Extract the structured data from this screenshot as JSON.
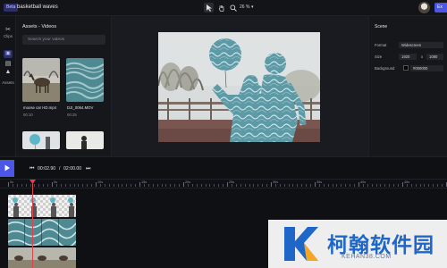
{
  "topbar": {
    "badge": "Beta",
    "project_title": "basketball waves",
    "zoom": "26 %",
    "export_label": "Ex"
  },
  "rail": {
    "items": [
      {
        "label": "Clips",
        "icon": "scissors-icon"
      },
      {
        "label": "Assets",
        "icon": "image-icon"
      }
    ]
  },
  "assets": {
    "title": "Assets - Videos",
    "search_placeholder": "Search your videos",
    "items": [
      {
        "name": "moose car HD.mp4",
        "duration": "00:10"
      },
      {
        "name": "DJI_0064.MOV",
        "duration": "00:25"
      }
    ]
  },
  "scene": {
    "title": "Scene",
    "format_label": "Format",
    "format_value": "Widescreen",
    "size_label": "Size",
    "width": "1920",
    "size_x": "x",
    "height": "1080",
    "background_label": "Background",
    "background_value": "#000000"
  },
  "playback": {
    "current_time": "00:02.90",
    "separator": "/",
    "total_time": "02:00.00"
  },
  "timeline": {
    "ruler_labels": [
      "0s",
      "5s",
      "10s",
      "15s",
      "20s",
      "25s",
      "30s",
      "35s",
      "40s",
      "45s",
      "50s",
      "55s",
      "1m"
    ]
  },
  "watermark": {
    "text": "柯翰软件园",
    "sub": "KEHAN38.COM"
  },
  "colors": {
    "accent": "#4b55e6",
    "playhead": "#e0424e",
    "background": "#0f1014"
  }
}
